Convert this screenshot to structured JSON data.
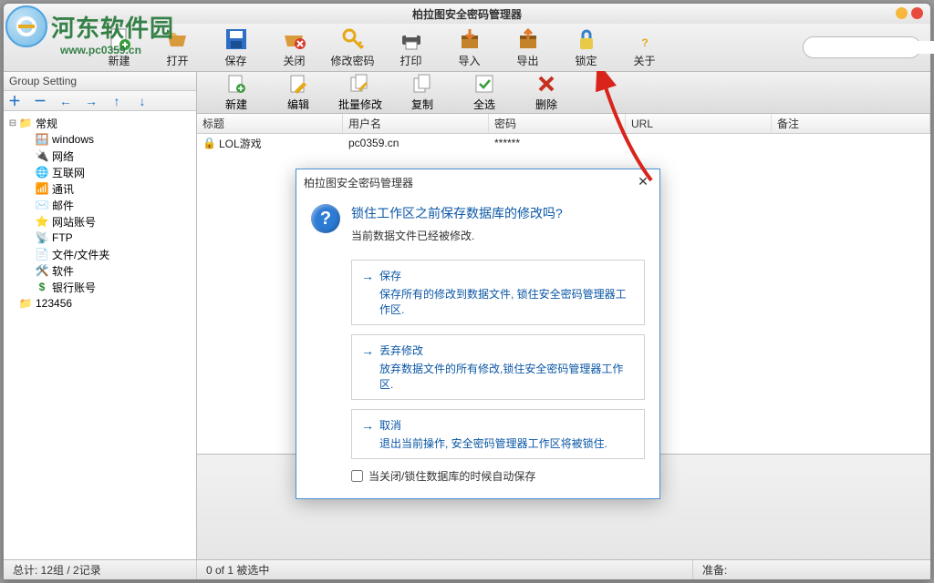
{
  "app_title": "柏拉图安全密码管理器",
  "watermark": {
    "text": "河东软件园",
    "url": "www.pc0359.cn"
  },
  "toolbar": [
    {
      "id": "new",
      "label": "新建"
    },
    {
      "id": "open",
      "label": "打开"
    },
    {
      "id": "save",
      "label": "保存"
    },
    {
      "id": "close",
      "label": "关闭"
    },
    {
      "id": "changepw",
      "label": "修改密码"
    },
    {
      "id": "print",
      "label": "打印"
    },
    {
      "id": "import",
      "label": "导入"
    },
    {
      "id": "export",
      "label": "导出"
    },
    {
      "id": "lock",
      "label": "锁定"
    },
    {
      "id": "about",
      "label": "关于"
    }
  ],
  "group": {
    "header": "Group Setting",
    "buttons": [
      "＋",
      "－",
      "←",
      "→",
      "↑",
      "↓"
    ],
    "root": {
      "label": "常规"
    },
    "children": [
      {
        "label": "windows",
        "icon": "win"
      },
      {
        "label": "网络",
        "icon": "net"
      },
      {
        "label": "互联网",
        "icon": "globe"
      },
      {
        "label": "通讯",
        "icon": "comm"
      },
      {
        "label": "邮件",
        "icon": "mail"
      },
      {
        "label": "网站账号",
        "icon": "star"
      },
      {
        "label": "FTP",
        "icon": "ftp"
      },
      {
        "label": "文件/文件夹",
        "icon": "file"
      },
      {
        "label": "软件",
        "icon": "soft"
      },
      {
        "label": "银行账号",
        "icon": "bank"
      }
    ],
    "second_root": {
      "label": "123456"
    }
  },
  "sec_toolbar": [
    {
      "id": "new2",
      "label": "新建"
    },
    {
      "id": "edit",
      "label": "编辑"
    },
    {
      "id": "batch",
      "label": "批量修改"
    },
    {
      "id": "copy",
      "label": "复制"
    },
    {
      "id": "selall",
      "label": "全选"
    },
    {
      "id": "delete",
      "label": "删除"
    }
  ],
  "columns": {
    "title": "标题",
    "user": "用户名",
    "pwd": "密码",
    "url": "URL",
    "note": "备注"
  },
  "rows": [
    {
      "title": "LOL游戏",
      "user": "pc0359.cn",
      "pwd": "******",
      "url": "",
      "note": ""
    }
  ],
  "status": {
    "left": "总计: 12组 / 2记录",
    "mid": "0 of 1 被选中",
    "right": "准备:"
  },
  "dialog": {
    "title": "柏拉图安全密码管理器",
    "question": "锁住工作区之前保存数据库的修改吗?",
    "sub": "当前数据文件已经被修改.",
    "options": [
      {
        "title": "保存",
        "desc": "保存所有的修改到数据文件, 锁住安全密码管理器工作区."
      },
      {
        "title": "丢弃修改",
        "desc": "放弃数据文件的所有修改,锁住安全密码管理器工作区."
      },
      {
        "title": "取消",
        "desc": "退出当前操作, 安全密码管理器工作区将被锁住."
      }
    ],
    "checkbox": "当关闭/锁住数据库的时候自动保存"
  }
}
